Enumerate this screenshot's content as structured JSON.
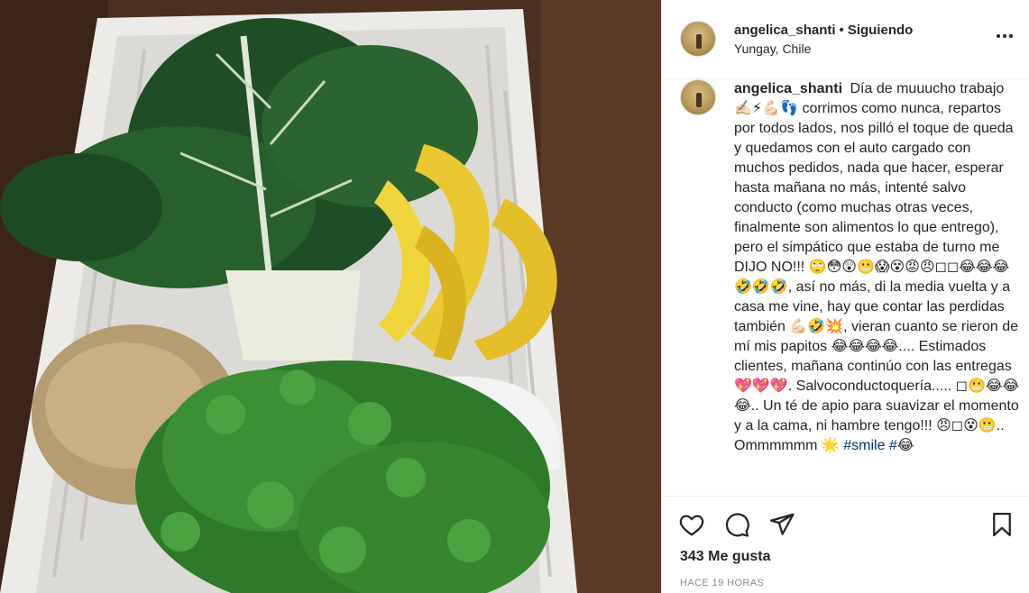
{
  "photo": {
    "alt": ""
  },
  "post": {
    "username": "angelica_shanti",
    "separator": "•",
    "follow_status": "Siguiendo",
    "location": "Yungay, Chile",
    "more_icon": "more-horizontal-icon",
    "more_label": "•••"
  },
  "caption": {
    "username": "angelica_shanti",
    "text": "Día de muuucho trabajo ✍🏻⚡💪🏻👣 corrimos como nunca, repartos por todos lados, nos pilló el toque de queda y quedamos con el auto cargado con muchos pedidos, nada que hacer, esperar hasta mañana no más, intenté salvo conducto (como muchas otras veces, finalmente son alimentos lo que entrego), pero el simpático que estaba de turno me DIJO NO!!! 🙄😳😲😬😱😵😡😠◻◻😂😂😂🤣🤣🤣, así no más, di la media vuelta y a casa me vine, hay que contar las perdidas también 💪🏻🤣💥, vieran cuanto se rieron de mí mis papitos 😂😂😂😂.... Estimados clientes, mañana continúo con las entregas 💖💖💖. Salvoconductoquería..... ◻😬😂😂😂.. Un té de apio para suavizar el momento y a la cama, ni hambre tengo!!! 😠◻😵😬.. Ommmmmm 🌟",
    "hashtag1": "#smile",
    "hashtag2": "#",
    "end_emoji": "😂"
  },
  "actions": {
    "like_icon": "heart-icon",
    "comment_icon": "comment-icon",
    "share_icon": "paper-plane-icon",
    "save_icon": "bookmark-icon"
  },
  "likes": "343 Me gusta",
  "timestamp": "HACE 19 HORAS",
  "colors": {
    "text": "#262626",
    "muted": "#8e8e8e",
    "hashtag": "#00376b",
    "border": "#efefef"
  }
}
